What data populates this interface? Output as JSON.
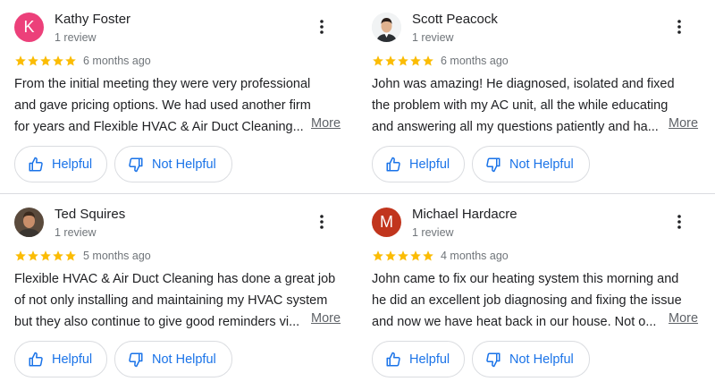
{
  "colors": {
    "star": "#fbbc04",
    "link": "#1a73e8",
    "secondary": "#70757a"
  },
  "reviews": [
    {
      "name": "Kathy Foster",
      "count": "1 review",
      "rating": 5,
      "age": "6 months ago",
      "avatar": {
        "type": "letter",
        "letter": "K",
        "color": "#ec407a"
      },
      "lines": [
        "From the initial meeting they were very professional",
        "and gave pricing options.  We had used another firm",
        "for years and Flexible HVAC & Air Duct Cleaning..."
      ],
      "more": "More",
      "helpful": "Helpful",
      "not_helpful": "Not Helpful"
    },
    {
      "name": "Scott Peacock",
      "count": "1 review",
      "rating": 5,
      "age": "6 months ago",
      "avatar": {
        "type": "photo",
        "icon": "person-photo-icon"
      },
      "lines": [
        "John was amazing! He diagnosed, isolated and fixed",
        "the problem with my AC unit, all the while educating",
        "and answering all my questions patiently and ha..."
      ],
      "more": "More",
      "helpful": "Helpful",
      "not_helpful": "Not Helpful"
    },
    {
      "name": "Ted Squires",
      "count": "1 review",
      "rating": 5,
      "age": "5 months ago",
      "avatar": {
        "type": "photo",
        "icon": "person-photo-icon"
      },
      "lines": [
        "Flexible HVAC & Air Duct Cleaning has done a great job",
        "of not only installing and maintaining my HVAC system",
        "but they also continue to give good reminders vi..."
      ],
      "more": "More",
      "helpful": "Helpful",
      "not_helpful": "Not Helpful"
    },
    {
      "name": "Michael Hardacre",
      "count": "1 review",
      "rating": 5,
      "age": "4 months ago",
      "avatar": {
        "type": "letter",
        "letter": "M",
        "color": "#c1351d"
      },
      "lines": [
        "John came to fix our heating system this morning and",
        "he did an excellent job diagnosing and fixing the issue",
        "and now we have heat back in our house. Not o..."
      ],
      "more": "More",
      "helpful": "Helpful",
      "not_helpful": "Not Helpful"
    }
  ]
}
